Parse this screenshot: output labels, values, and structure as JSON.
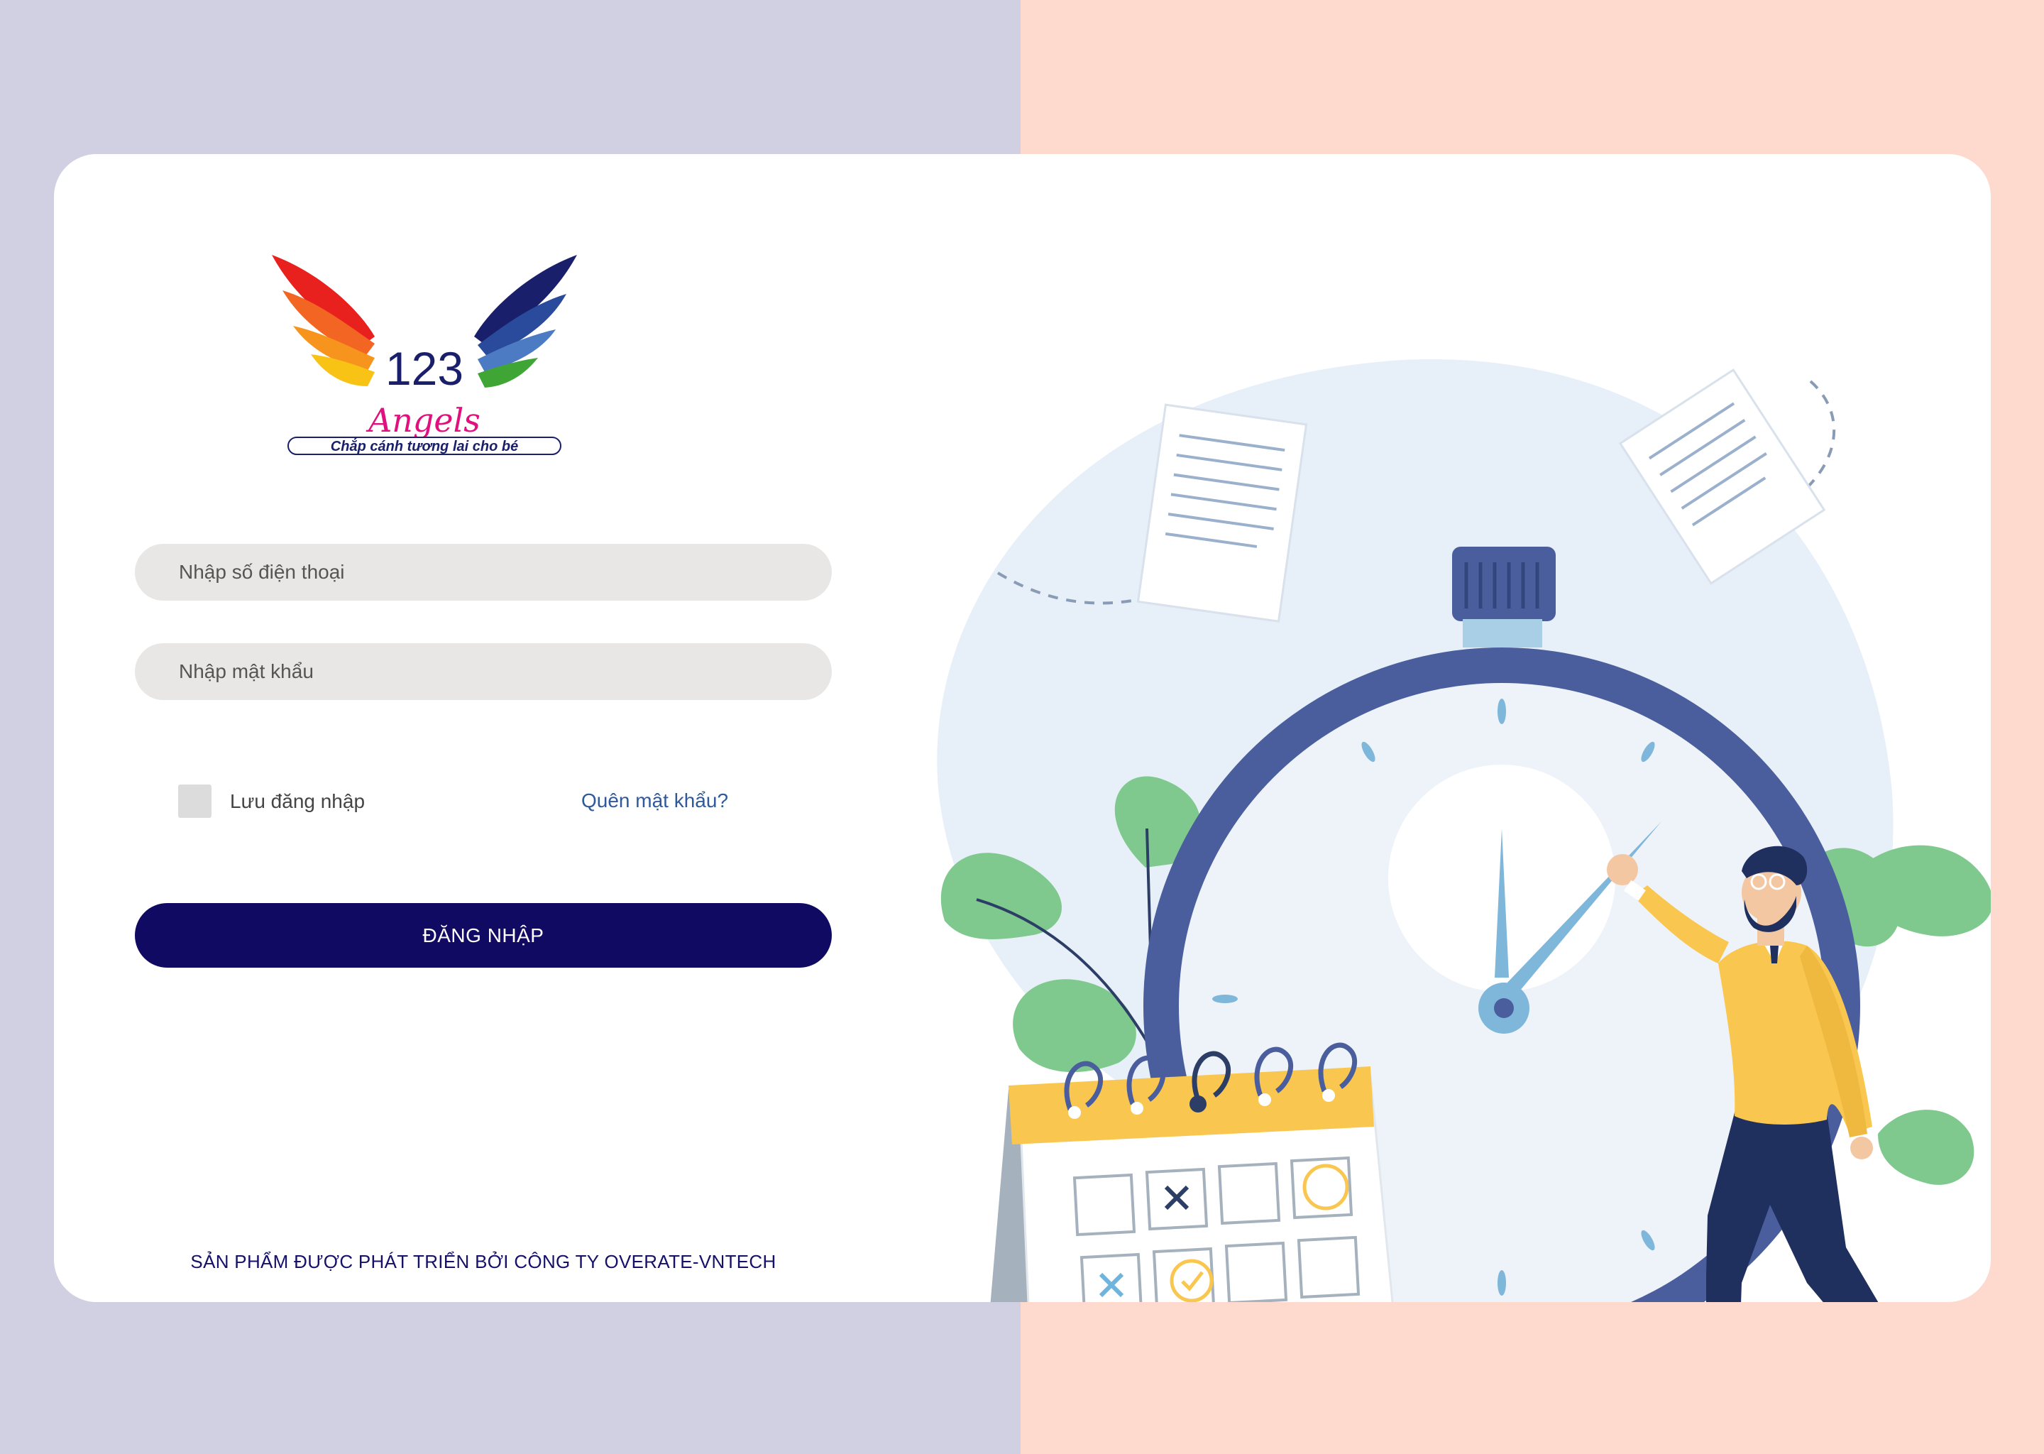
{
  "brand": {
    "logo_number": "123",
    "logo_name": "Angels",
    "logo_tagline": "Chắp cánh tương lai cho bé"
  },
  "form": {
    "phone_placeholder": "Nhập số điện thoại",
    "password_placeholder": "Nhập mật khẩu",
    "remember_label": "Lưu đăng nhập",
    "remember_checked": false,
    "forgot_label": "Quên mật khẩu?",
    "login_label": "ĐĂNG NHẬP"
  },
  "footer": {
    "text": "SẢN PHẨM ĐƯỢC PHÁT TRIỂN BỞI CÔNG TY OVERATE-VNTECH"
  },
  "colors": {
    "left_background": "#D0D0E2",
    "right_background": "#FDD9CE",
    "primary_button": "#110A63",
    "link": "#2E5A9C",
    "input_background": "#E9E6E6"
  },
  "icons": {
    "illustration": "stopwatch-calendar-man-illustration",
    "checkbox": "checkbox-unchecked"
  }
}
